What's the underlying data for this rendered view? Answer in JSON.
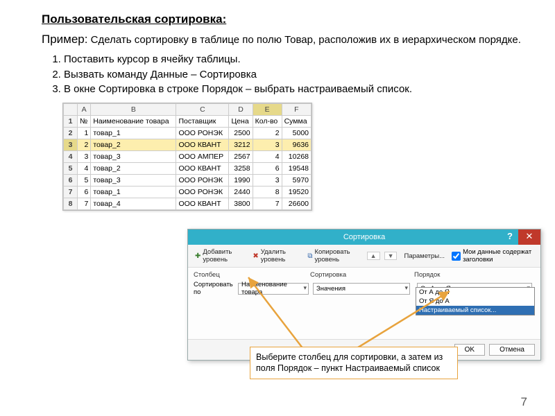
{
  "title": "Пользовательская сортировка:",
  "example_label": "Пример:",
  "example_text": "Сделать сортировку в таблице по полю Товар, расположив их в иерархическом порядке.",
  "steps": [
    "Поставить курсор в ячейку таблицы.",
    "Вызвать команду Данные – Сортировка",
    "В окне Сортировка в строке Порядок – выбрать настраиваемый список."
  ],
  "chart_data": {
    "type": "table",
    "columns": [
      "A",
      "B",
      "C",
      "D",
      "E",
      "F"
    ],
    "header_row": [
      "№",
      "Наименование товара",
      "Поставщик",
      "Цена",
      "Кол-во",
      "Сумма"
    ],
    "rows": [
      [
        "1",
        "товар_1",
        "ООО РОНЭК",
        "2500",
        "2",
        "5000"
      ],
      [
        "2",
        "товар_2",
        "ООО КВАНТ",
        "3212",
        "3",
        "9636"
      ],
      [
        "3",
        "товар_3",
        "ООО АМПЕР",
        "2567",
        "4",
        "10268"
      ],
      [
        "4",
        "товар_2",
        "ООО КВАНТ",
        "3258",
        "6",
        "19548"
      ],
      [
        "5",
        "товар_3",
        "ООО РОНЭК",
        "1990",
        "3",
        "5970"
      ],
      [
        "6",
        "товар_1",
        "ООО РОНЭК",
        "2440",
        "8",
        "19520"
      ],
      [
        "7",
        "товар_4",
        "ООО КВАНТ",
        "3800",
        "7",
        "26600"
      ]
    ],
    "row_labels": [
      "1",
      "2",
      "3",
      "4",
      "5",
      "6",
      "7",
      "8"
    ],
    "selected_col": "E",
    "selected_row_label": "3"
  },
  "dialog": {
    "title": "Сортировка",
    "toolbar": {
      "add": "Добавить уровень",
      "del": "Удалить уровень",
      "copy": "Копировать уровень",
      "params": "Параметры...",
      "checkbox": "Мои данные содержат заголовки"
    },
    "headers": {
      "col": "Столбец",
      "sort": "Сортировка",
      "order": "Порядок"
    },
    "row": {
      "label": "Сортировать по",
      "column_val": "Наименование товара",
      "sort_val": "Значения",
      "order_val": "От А до Я"
    },
    "dropdown_open": [
      "От А до Я",
      "От Я до А",
      "Настраиваемый список..."
    ],
    "buttons": {
      "ok": "OK",
      "cancel": "Отмена"
    }
  },
  "callout": "Выберите столбец для сортировки, а затем из поля Порядок – пункт Настраиваемый список",
  "page_number": "7"
}
